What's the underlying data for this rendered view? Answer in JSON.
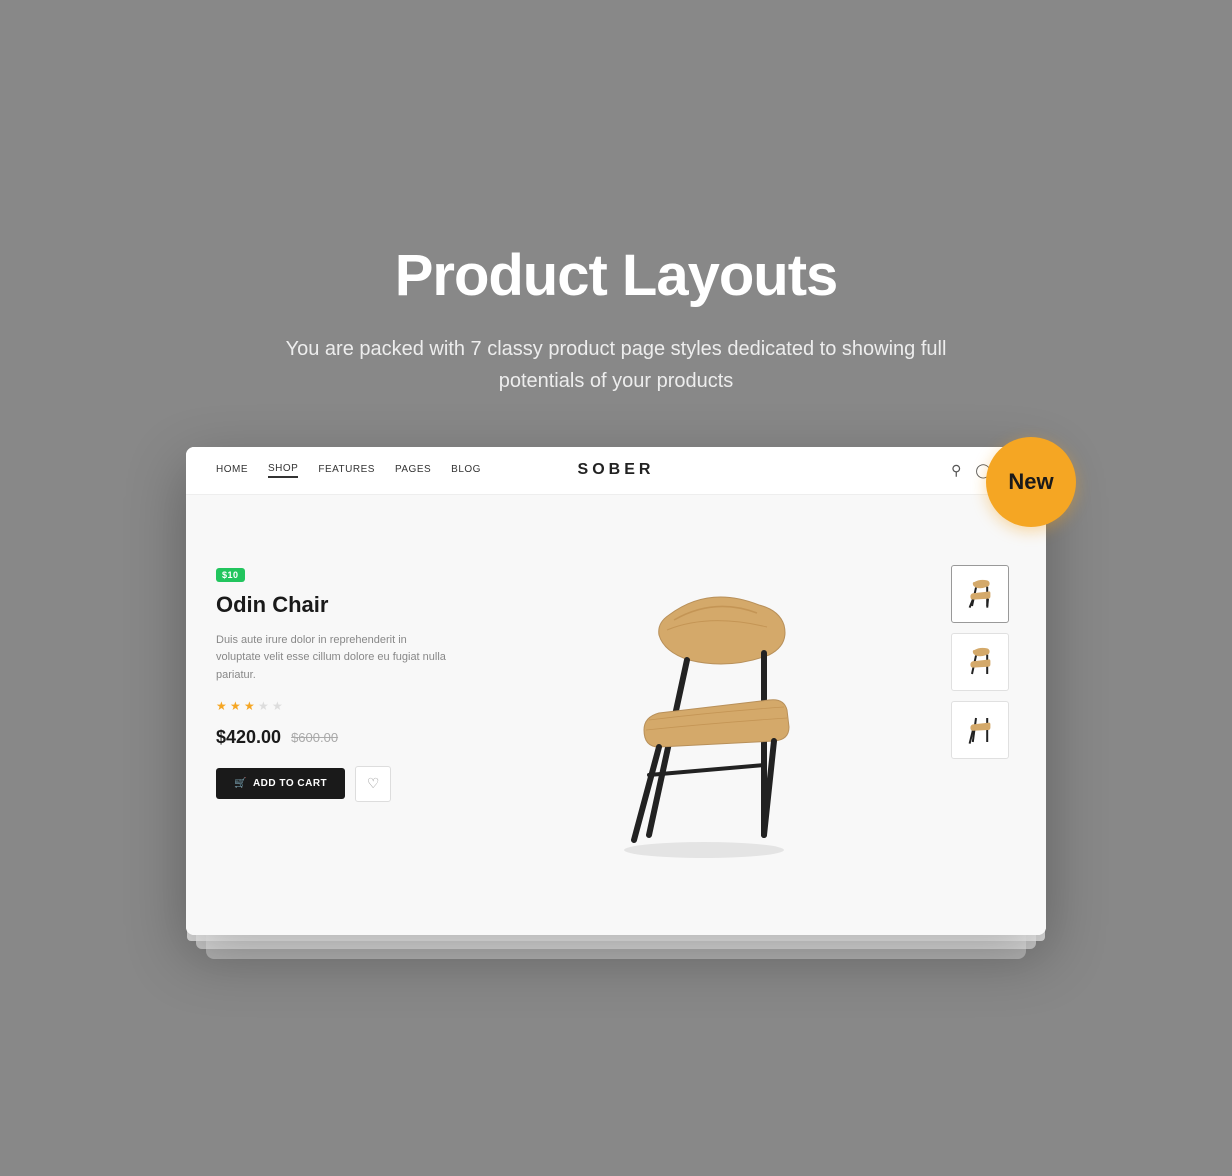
{
  "header": {
    "title": "Product Layouts",
    "subtitle": "You are packed with 7 classy product page styles dedicated to showing full potentials of your products"
  },
  "new_badge": {
    "label": "New"
  },
  "nav": {
    "links": [
      {
        "label": "HOME",
        "active": false
      },
      {
        "label": "SHOP",
        "active": true
      },
      {
        "label": "FEATURES",
        "active": false
      },
      {
        "label": "PAGES",
        "active": false
      },
      {
        "label": "BLOG",
        "active": false
      }
    ],
    "logo": "SOBER"
  },
  "product": {
    "badge": "$10",
    "name": "Odin Chair",
    "description": "Duis aute irure dolor in reprehenderit in voluptate velit esse cillum dolore eu fugiat nulla pariatur.",
    "stars": [
      true,
      true,
      true,
      false,
      false
    ],
    "price_current": "$420.00",
    "price_original": "$600.00",
    "add_to_cart_label": "Add To Cart",
    "cart_icon": "🛒"
  }
}
